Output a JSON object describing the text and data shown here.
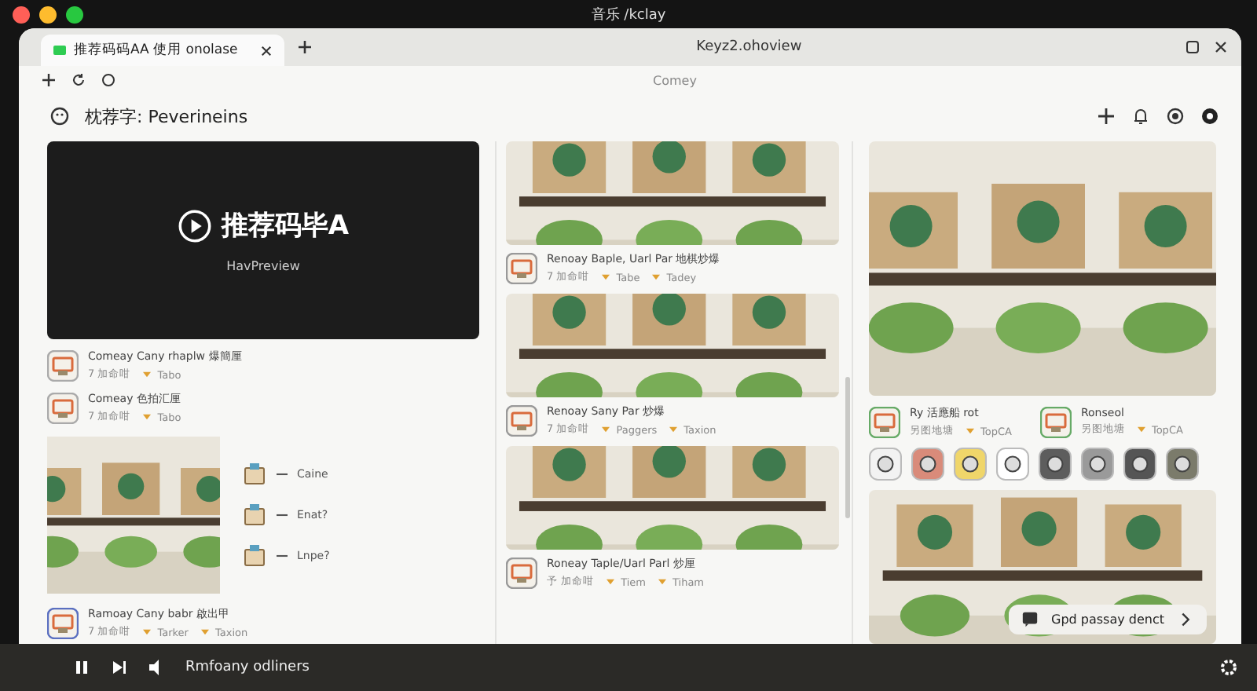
{
  "window": {
    "title": "音乐 /kclay"
  },
  "tabs": [
    {
      "label": "推荐码码AA 使用 onolase",
      "selected": true
    }
  ],
  "address": {
    "title": "Keyz2.ohoview",
    "subtitle": "Comey"
  },
  "header": {
    "title": "枕荐字: Peverineins"
  },
  "hero": {
    "title": "推荐码毕A",
    "caption": "HavPreview"
  },
  "left_items": [
    {
      "title": "Comeay Cany rhaplw 爆簡厘",
      "meta": [
        "7 加命咁",
        "Tabo"
      ]
    },
    {
      "title": "Comeay 色拍汇厘",
      "meta": [
        "7 加命咁",
        "Tabo"
      ]
    }
  ],
  "sketch_labels": [
    "Caine",
    "Enat?",
    "Lnpe?"
  ],
  "left_footer": {
    "title": "Ramoay Cany babr 啟出甲",
    "meta": [
      "7 加命咁",
      "Tarker",
      "Taxion"
    ]
  },
  "middle_cards": [
    {
      "caption": "Renoay Baple, Uarl Par 地棋炒爆",
      "meta": [
        "7 加命咁",
        "Tabe",
        "Tadey"
      ]
    },
    {
      "caption": "Renoay Sany Par 炒爆",
      "meta": [
        "7 加命咁",
        "Paggers",
        "Taxion"
      ]
    },
    {
      "caption": "Roneay Taple/Uarl Parl 炒厘",
      "meta": [
        "予 加命咁",
        "Tiem",
        "Tiham"
      ]
    }
  ],
  "right_items": [
    {
      "title": "Ry 活應船 rot",
      "meta": [
        "另图地塘",
        "TopCA"
      ]
    },
    {
      "title": "Ronseol",
      "meta": [
        "另图地塘",
        "TopCA"
      ]
    }
  ],
  "toast": {
    "text": "Gpd passay denct"
  },
  "player": {
    "track": "Rmfoany odliners",
    "playing": true
  }
}
